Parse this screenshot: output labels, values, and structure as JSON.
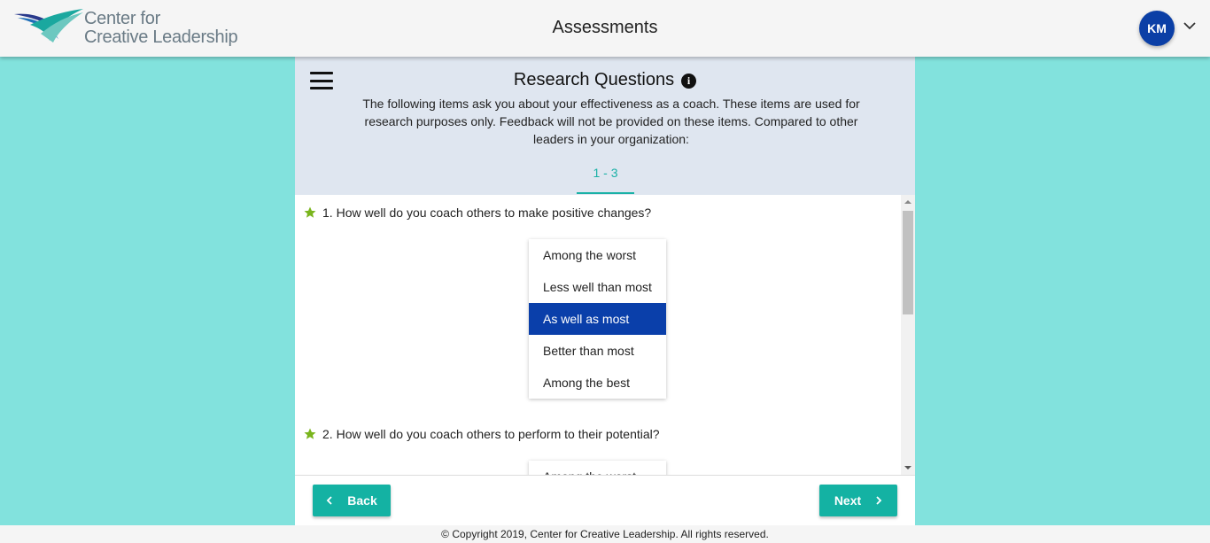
{
  "header": {
    "logo_line1": "Center for",
    "logo_line2": "Creative Leadership",
    "title": "Assessments",
    "user_initials": "KM"
  },
  "section": {
    "title": "Research Questions",
    "description": "The following items ask you about your effectiveness as a coach. These items are used for research purposes only. Feedback will not be provided on these items. Compared to other leaders in your organization:",
    "page_tab": "1 - 3"
  },
  "questions": [
    {
      "number": "1.",
      "text": "How well do you coach others to make positive changes?",
      "options": [
        "Among the worst",
        "Less well than most",
        "As well as most",
        "Better than most",
        "Among the best"
      ],
      "selected": "As well as most"
    },
    {
      "number": "2.",
      "text": "How well do you coach others to perform to their potential?",
      "options": [
        "Among the worst"
      ]
    }
  ],
  "nav": {
    "back_label": "Back",
    "next_label": "Next"
  },
  "footer": {
    "copyright": "© Copyright 2019, Center for Creative Leadership. All rights reserved."
  },
  "colors": {
    "page_background": "#82e2dd",
    "accent": "#14b2a3",
    "selected_option": "#0a3faa",
    "avatar": "#0b3fa6",
    "required_star": "#7ab51d"
  },
  "icons": [
    "logo-mark",
    "menu-icon",
    "info-icon",
    "star-icon",
    "chevron-left-icon",
    "chevron-right-icon",
    "chevron-down-icon"
  ]
}
